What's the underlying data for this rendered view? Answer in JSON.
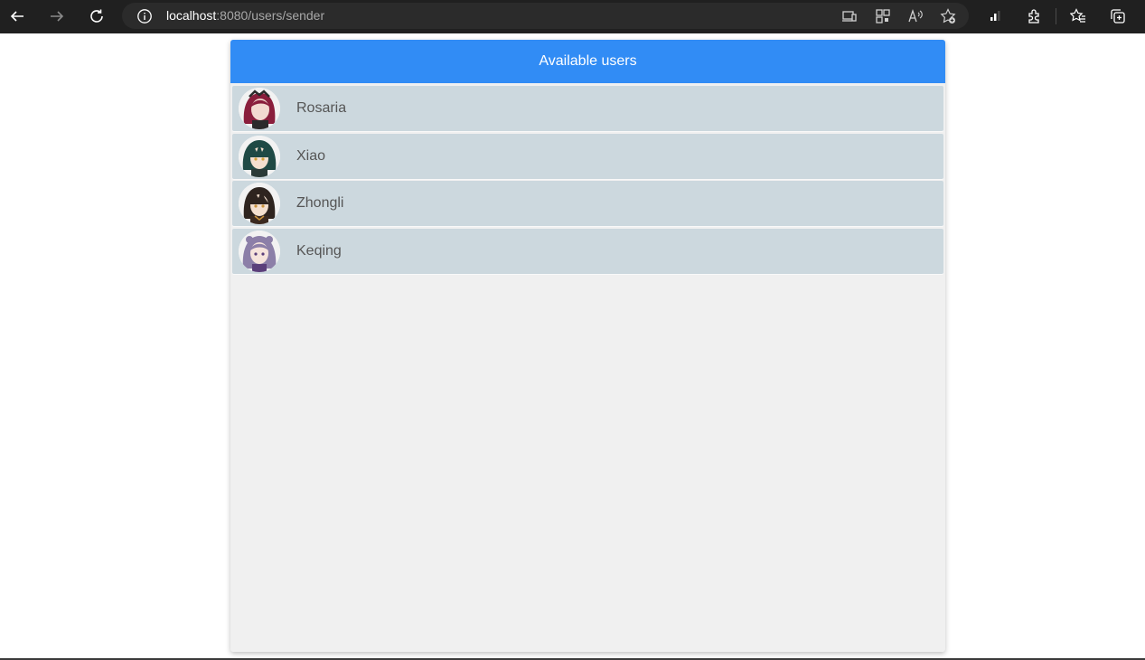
{
  "browser": {
    "url_host": "localhost",
    "url_rest": ":8080/users/sender",
    "icons": [
      "back-icon",
      "forward-icon",
      "refresh-icon",
      "info-icon",
      "app-available-icon",
      "qr-code-icon",
      "read-aloud-icon",
      "add-favorite-icon",
      "performance-icon",
      "extensions-icon",
      "favorites-icon",
      "collections-icon"
    ]
  },
  "panel": {
    "title": "Available users"
  },
  "users": [
    {
      "name": "Rosaria",
      "hair": "#8a1e3c",
      "accent": "#2b2b2b"
    },
    {
      "name": "Xiao",
      "hair": "#1f4a45",
      "accent": "#d4a23a"
    },
    {
      "name": "Zhongli",
      "hair": "#2e241f",
      "accent": "#c9923b"
    },
    {
      "name": "Keqing",
      "hair": "#8c7fa8",
      "accent": "#5b3f7a"
    }
  ],
  "colors": {
    "header": "#318cf5",
    "row": "#ccd8de",
    "panel_bg": "#f0f0f0",
    "toolbar_bg": "#202020"
  }
}
